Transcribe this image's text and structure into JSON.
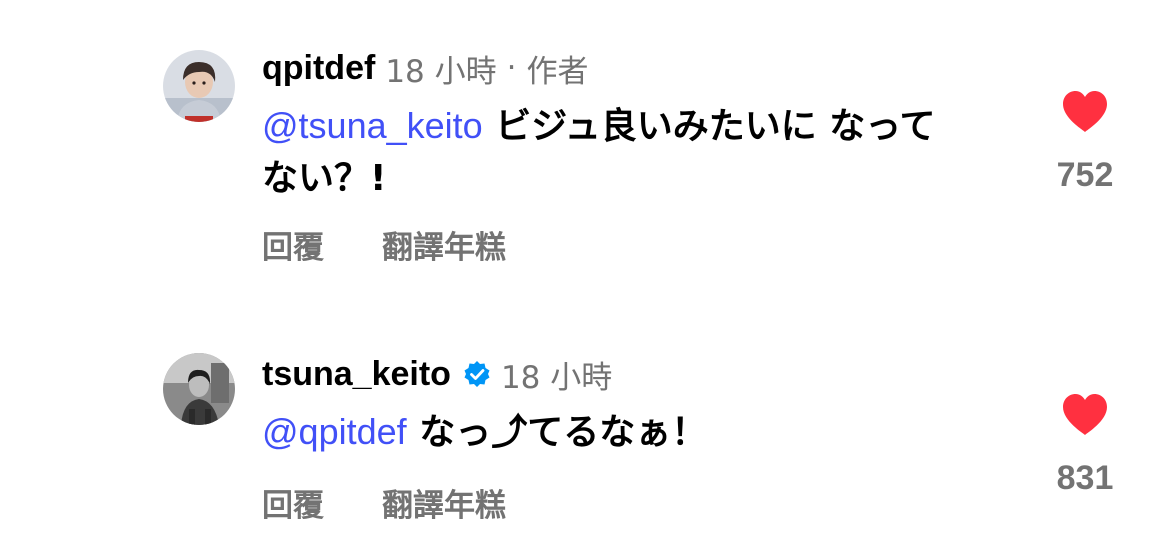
{
  "comments": [
    {
      "username": "qpitdef",
      "time": "18 小時",
      "separator": "·",
      "author_tag": "作者",
      "mention": "@tsuna_keito",
      "text": "ビジュ良いみたいに なってない？!",
      "reply_label": "回覆",
      "translate_label": "翻譯年糕",
      "like_count": "752",
      "verified": false
    },
    {
      "username": "tsuna_keito",
      "time": "18 小時",
      "mention": "@qpitdef",
      "text": "なっ⤴てるなぁ！",
      "reply_label": "回覆",
      "translate_label": "翻譯年糕",
      "like_count": "831",
      "verified": true
    }
  ],
  "colors": {
    "mention": "#4150f7",
    "meta": "#737373",
    "heart": "#ff3040",
    "verified": "#0095f6"
  },
  "icons": {
    "like": "heart-icon",
    "verified": "verified-badge-icon"
  }
}
